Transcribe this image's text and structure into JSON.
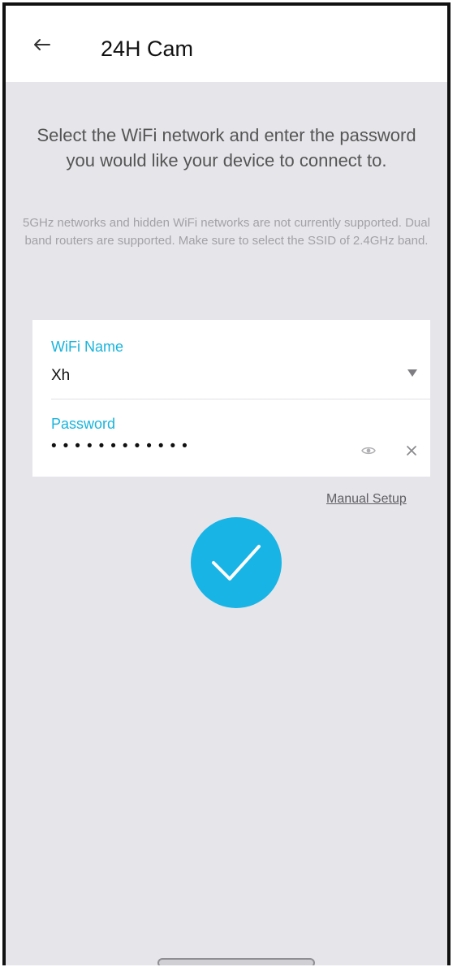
{
  "header": {
    "title": "24H Cam",
    "back_icon": "arrow-left-icon"
  },
  "instruction": "Select the WiFi network and enter the password you would like your device to connect to.",
  "note": "5GHz networks and hidden WiFi networks are not currently supported. Dual band routers are supported. Make sure to select the SSID of 2.4GHz band.",
  "form": {
    "wifi_name": {
      "label": "WiFi Name",
      "value": "Xh",
      "icon": "dropdown-triangle-icon"
    },
    "password": {
      "label": "Password",
      "value": "••••••••••••",
      "eye_icon": "eye-icon",
      "clear_icon": "close-icon"
    }
  },
  "manual_setup": "Manual Setup",
  "confirm_button": {
    "icon": "check-icon",
    "color": "#18b4e6"
  },
  "colors": {
    "accent": "#18b4dc",
    "background": "#e6e5ea",
    "note_text": "#a2a2a6",
    "instruction_text": "#555555"
  }
}
